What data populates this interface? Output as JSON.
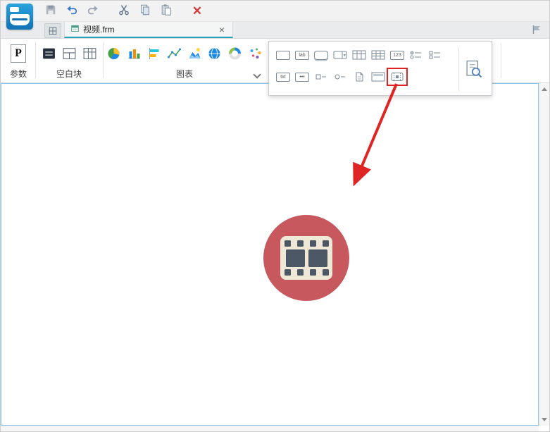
{
  "colors": {
    "accent": "#1886c8",
    "tab-underline": "#22a2bd",
    "annotation-red": "#e02424",
    "video-circle": "#c7585e",
    "film-body": "#efe8d6",
    "film-dark": "#4c5866"
  },
  "toolbar": {
    "delete_glyph": "✕"
  },
  "tabs": {
    "active": "视频.frm",
    "close_glyph": "×"
  },
  "ribbon": {
    "param_letter": "P",
    "groups": [
      {
        "label": "参数"
      },
      {
        "label": "空白块"
      },
      {
        "label": "图表"
      }
    ]
  },
  "palette": {
    "labels": {
      "label": "lab",
      "number": "123",
      "text": "txt",
      "password": "•••"
    }
  }
}
